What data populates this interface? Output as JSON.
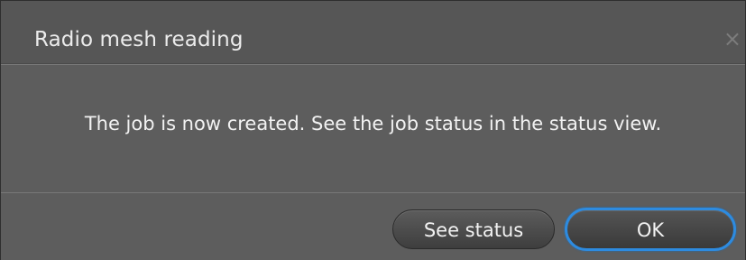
{
  "dialog": {
    "title": "Radio mesh reading",
    "close_glyph": "×",
    "message": "The job is now created. See the job status in the status view.",
    "buttons": {
      "see_status": "See status",
      "ok": "OK"
    },
    "colors": {
      "accent": "#2d8be0",
      "background": "#5d5d5d",
      "text": "#f2f2f2"
    }
  }
}
